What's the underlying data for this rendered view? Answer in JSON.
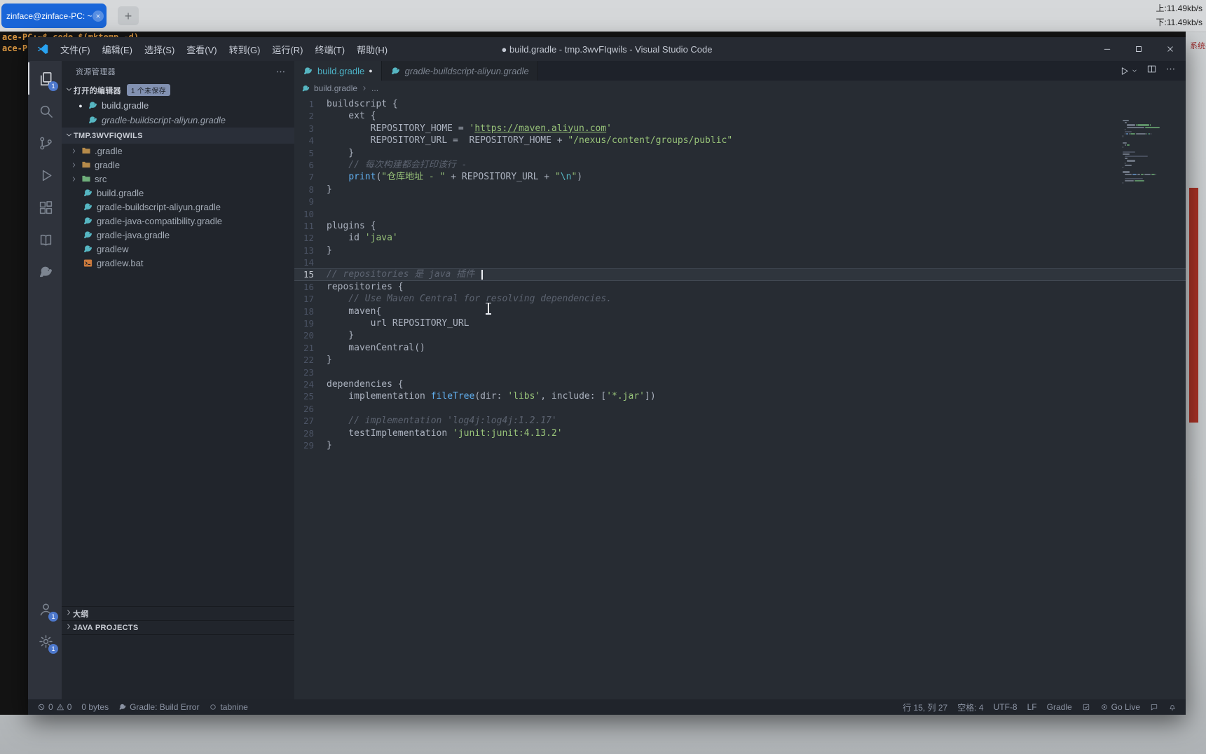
{
  "colors": {
    "terminal_tab_blue": "#1a66d9",
    "terminal_orange": "#de9a43",
    "red_strip": "#a93226",
    "badge_blue": "#4d78cc",
    "active_tab_teal": "#4db3c7",
    "string_green": "#98c379",
    "comment_gray": "#5c6370",
    "function_blue": "#61afef",
    "gradle_teal": "#56b6c2",
    "bat_orange": "#cc7a3d",
    "folder_tan": "#b58a4a",
    "folder_green": "#6fae7b"
  },
  "desktop": {
    "terminal_tab": "zinface@zinface-PC: ~",
    "terminal_tab_close_icon": "x-icon",
    "new_tab_label": "+",
    "net_up": "上:11.49kb/s",
    "net_down": "下:11.49kb/s",
    "terminal_line1": "ace-PC:~$ code $(mktemp -d)",
    "terminal_line2": "ace-PC:~",
    "system_label": "系统共运行"
  },
  "vscode": {
    "title_bar": {
      "logo_icon": "vscode-logo",
      "menus": [
        "文件(F)",
        "编辑(E)",
        "选择(S)",
        "查看(V)",
        "转到(G)",
        "运行(R)",
        "终端(T)",
        "帮助(H)"
      ],
      "title": "● build.gradle - tmp.3wvFIqwils - Visual Studio Code",
      "controls": [
        "minimize-icon",
        "maximize-icon",
        "close-icon"
      ]
    },
    "activity_bar": {
      "top": [
        {
          "name": "explorer-icon",
          "badge": "1",
          "active": true
        },
        {
          "name": "search-icon"
        },
        {
          "name": "source-control-icon"
        },
        {
          "name": "run-debug-icon"
        },
        {
          "name": "extensions-icon"
        },
        {
          "name": "docs-icon"
        },
        {
          "name": "gradle-icon"
        }
      ],
      "bottom": [
        {
          "name": "account-icon",
          "badge": "1"
        },
        {
          "name": "settings-icon",
          "badge": "1"
        }
      ]
    },
    "sidebar": {
      "title": "资源管理器",
      "more_icon": "more-icon",
      "open_editors": {
        "label": "打开的编辑器",
        "badge": "1 个未保存",
        "items": [
          {
            "label": "build.gradle",
            "icon": "gradle-file-icon",
            "modified": true
          },
          {
            "label": "gradle-buildscript-aliyun.gradle",
            "icon": "gradle-file-icon",
            "preview": true
          }
        ]
      },
      "project": {
        "label": "TMP.3WVFIQWILS",
        "tree": [
          {
            "type": "folder",
            "label": ".gradle",
            "color": "#b58a4a"
          },
          {
            "type": "folder",
            "label": "gradle",
            "color": "#b58a4a"
          },
          {
            "type": "folder",
            "label": "src",
            "color": "#6fae7b"
          },
          {
            "type": "file",
            "label": "build.gradle",
            "icon": "gradle-file-icon"
          },
          {
            "type": "file",
            "label": "gradle-buildscript-aliyun.gradle",
            "icon": "gradle-file-icon"
          },
          {
            "type": "file",
            "label": "gradle-java-compatibility.gradle",
            "icon": "gradle-file-icon"
          },
          {
            "type": "file",
            "label": "gradle-java.gradle",
            "icon": "gradle-file-icon"
          },
          {
            "type": "file",
            "label": "gradlew",
            "icon": "gradle-file-icon"
          },
          {
            "type": "file",
            "label": "gradlew.bat",
            "icon": "bat-file-icon"
          }
        ]
      },
      "outline_label": "大纲",
      "java_projects_label": "JAVA PROJECTS"
    },
    "editor": {
      "tabs": [
        {
          "label": "build.gradle",
          "icon": "gradle-file-icon",
          "active": true,
          "modified": true
        },
        {
          "label": "gradle-buildscript-aliyun.gradle",
          "icon": "gradle-file-icon",
          "preview": true
        }
      ],
      "tab_actions": [
        "run-icon",
        "chevron-down-icon",
        "split-editor-icon",
        "more-icon"
      ],
      "breadcrumb": {
        "icon": "gradle-file-icon",
        "items": [
          "build.gradle",
          "..."
        ]
      },
      "active_line": 15,
      "lines": [
        {
          "seg": [
            [
              "p",
              "buildscript {"
            ]
          ]
        },
        {
          "seg": [
            [
              "p",
              "    ext {"
            ]
          ]
        },
        {
          "seg": [
            [
              "p",
              "        REPOSITORY_HOME = "
            ],
            [
              "s",
              "'"
            ],
            [
              "u",
              "https://maven.aliyun.com"
            ],
            [
              "s",
              "'"
            ]
          ]
        },
        {
          "seg": [
            [
              "p",
              "        REPOSITORY_URL =  REPOSITORY_HOME + "
            ],
            [
              "s",
              "\"/nexus/content/groups/public\""
            ]
          ]
        },
        {
          "seg": [
            [
              "p",
              "    }"
            ]
          ]
        },
        {
          "seg": [
            [
              "c",
              "    // 每次构建都会打印该行 -"
            ]
          ]
        },
        {
          "seg": [
            [
              "p",
              "    "
            ],
            [
              "f",
              "print"
            ],
            [
              "p",
              "("
            ],
            [
              "s",
              "\"仓库地址 - \""
            ],
            [
              "p",
              " + REPOSITORY_URL + "
            ],
            [
              "s",
              "\""
            ],
            [
              "e",
              "\\n"
            ],
            [
              "s",
              "\""
            ],
            [
              "p",
              ")"
            ]
          ]
        },
        {
          "seg": [
            [
              "p",
              "}"
            ]
          ]
        },
        {
          "seg": []
        },
        {
          "seg": []
        },
        {
          "seg": [
            [
              "p",
              "plugins {"
            ]
          ]
        },
        {
          "seg": [
            [
              "p",
              "    id "
            ],
            [
              "s",
              "'java'"
            ]
          ]
        },
        {
          "seg": [
            [
              "p",
              "}"
            ]
          ]
        },
        {
          "seg": []
        },
        {
          "seg": [
            [
              "c",
              "// repositories 是 java 插件 "
            ]
          ],
          "caret": true
        },
        {
          "seg": [
            [
              "p",
              "repositories {"
            ]
          ]
        },
        {
          "seg": [
            [
              "c",
              "    // Use Maven Central for resolving dependencies."
            ]
          ]
        },
        {
          "seg": [
            [
              "p",
              "    maven{"
            ]
          ]
        },
        {
          "seg": [
            [
              "p",
              "        url REPOSITORY_URL"
            ]
          ]
        },
        {
          "seg": [
            [
              "p",
              "    }"
            ]
          ]
        },
        {
          "seg": [
            [
              "p",
              "    mavenCentral()"
            ]
          ]
        },
        {
          "seg": [
            [
              "p",
              "}"
            ]
          ]
        },
        {
          "seg": []
        },
        {
          "seg": [
            [
              "p",
              "dependencies {"
            ]
          ]
        },
        {
          "seg": [
            [
              "p",
              "    implementation "
            ],
            [
              "f",
              "fileTree"
            ],
            [
              "p",
              "(dir: "
            ],
            [
              "s",
              "'libs'"
            ],
            [
              "p",
              ", include: ["
            ],
            [
              "s",
              "'*.jar'"
            ],
            [
              "p",
              "])"
            ]
          ]
        },
        {
          "seg": []
        },
        {
          "seg": [
            [
              "c",
              "    // implementation 'log4j:log4j:1.2.17'"
            ]
          ]
        },
        {
          "seg": [
            [
              "p",
              "    testImplementation "
            ],
            [
              "s",
              "'junit:junit:4.13.2'"
            ]
          ]
        },
        {
          "seg": [
            [
              "p",
              "}"
            ]
          ]
        }
      ]
    },
    "status_bar": {
      "left": [
        {
          "name": "problems",
          "parts": [
            {
              "i": "error-icon"
            },
            {
              "t": "0"
            },
            {
              "i": "warning-icon"
            },
            {
              "t": "0"
            }
          ]
        },
        {
          "name": "file-size",
          "parts": [
            {
              "t": "0 bytes"
            }
          ]
        },
        {
          "name": "gradle-build-status",
          "parts": [
            {
              "i": "gradle-icon"
            },
            {
              "t": "Gradle: Build Error"
            }
          ]
        },
        {
          "name": "tabnine",
          "parts": [
            {
              "i": "circle-icon"
            },
            {
              "t": "tabnine"
            }
          ]
        }
      ],
      "right": [
        {
          "name": "cursor-position",
          "parts": [
            {
              "t": "行 15, 列 27"
            }
          ]
        },
        {
          "name": "indentation",
          "parts": [
            {
              "t": "空格: 4"
            }
          ]
        },
        {
          "name": "encoding",
          "parts": [
            {
              "t": "UTF-8"
            }
          ]
        },
        {
          "name": "eol",
          "parts": [
            {
              "t": "LF"
            }
          ]
        },
        {
          "name": "language-mode",
          "parts": [
            {
              "t": "Gradle"
            }
          ]
        },
        {
          "name": "extension-status",
          "parts": [
            {
              "i": "check-icon"
            }
          ]
        },
        {
          "name": "go-live",
          "parts": [
            {
              "i": "broadcast-icon"
            },
            {
              "t": "Go Live"
            }
          ]
        },
        {
          "name": "feedback",
          "parts": [
            {
              "i": "feedback-icon"
            }
          ]
        },
        {
          "name": "notifications",
          "parts": [
            {
              "i": "bell-icon"
            }
          ]
        }
      ]
    }
  }
}
